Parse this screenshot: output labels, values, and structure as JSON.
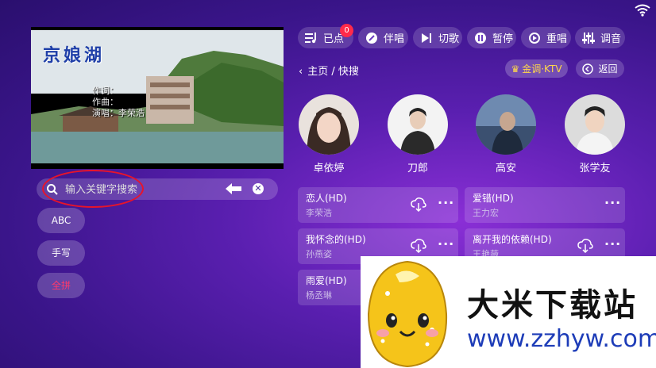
{
  "video": {
    "title_overlay": "京娘湖",
    "credits": [
      "作词：",
      "作曲：",
      "演唱：李荣浩"
    ]
  },
  "search": {
    "placeholder": "输入关键字搜索",
    "backspace_icon": "backspace-arrow-icon",
    "clear_icon": "close-circle-icon"
  },
  "keyboard_modes": [
    "ABC",
    "手写",
    "全拼"
  ],
  "toolbar": [
    {
      "label": "已点",
      "icon": "queue-list-icon",
      "badge": "0"
    },
    {
      "label": "伴唱",
      "icon": "mic-toggle-icon"
    },
    {
      "label": "切歌",
      "icon": "next-track-icon"
    },
    {
      "label": "暂停",
      "icon": "pause-icon"
    },
    {
      "label": "重唱",
      "icon": "replay-icon"
    },
    {
      "label": "调音",
      "icon": "equalizer-icon"
    }
  ],
  "breadcrumb": "主页 / 快搜",
  "ktv_chip": "金调·KTV",
  "back_label": "返回",
  "artists": [
    "卓依婷",
    "刀郎",
    "高安",
    "张学友"
  ],
  "songs": [
    {
      "title": "恋人(HD)",
      "artist": "李荣浩"
    },
    {
      "title": "爱错(HD)",
      "artist": "王力宏"
    },
    {
      "title": "我怀念的(HD)",
      "artist": "孙燕姿"
    },
    {
      "title": "离开我的依赖(HD)",
      "artist": "王艳薇"
    },
    {
      "title": "雨爱(HD)",
      "artist": "杨丞琳"
    }
  ],
  "watermark": {
    "text": "大米下载站",
    "url": "www.zzhyw.com"
  },
  "colors": {
    "accent_badge": "#ff2a4a",
    "annotation_red": "#e8142a",
    "gold": "#ffd84a"
  }
}
